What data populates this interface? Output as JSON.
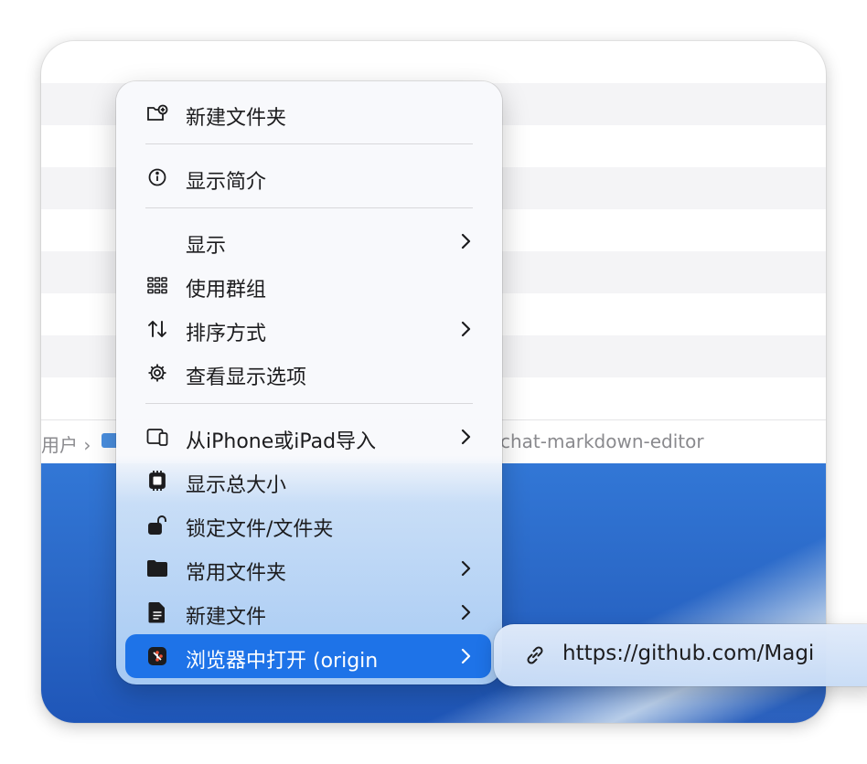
{
  "pathbar": {
    "left_text": "用户 ›",
    "right_text": "chat-markdown-editor"
  },
  "menu": {
    "new_folder": "新建文件夹",
    "get_info": "显示简介",
    "show": "显示",
    "use_groups": "使用群组",
    "sort_by": "排序方式",
    "view_options": "查看显示选项",
    "import_from_iphone": "从iPhone或iPad导入",
    "show_total_size": "显示总大小",
    "lock_file": "锁定文件/文件夹",
    "common_folders": "常用文件夹",
    "new_file": "新建文件",
    "open_in_browser": "浏览器中打开 (origin"
  },
  "submenu": {
    "url": "https://github.com/Magi"
  },
  "colors": {
    "accent": "#1e73e8",
    "desktop": "#2b69c8"
  }
}
